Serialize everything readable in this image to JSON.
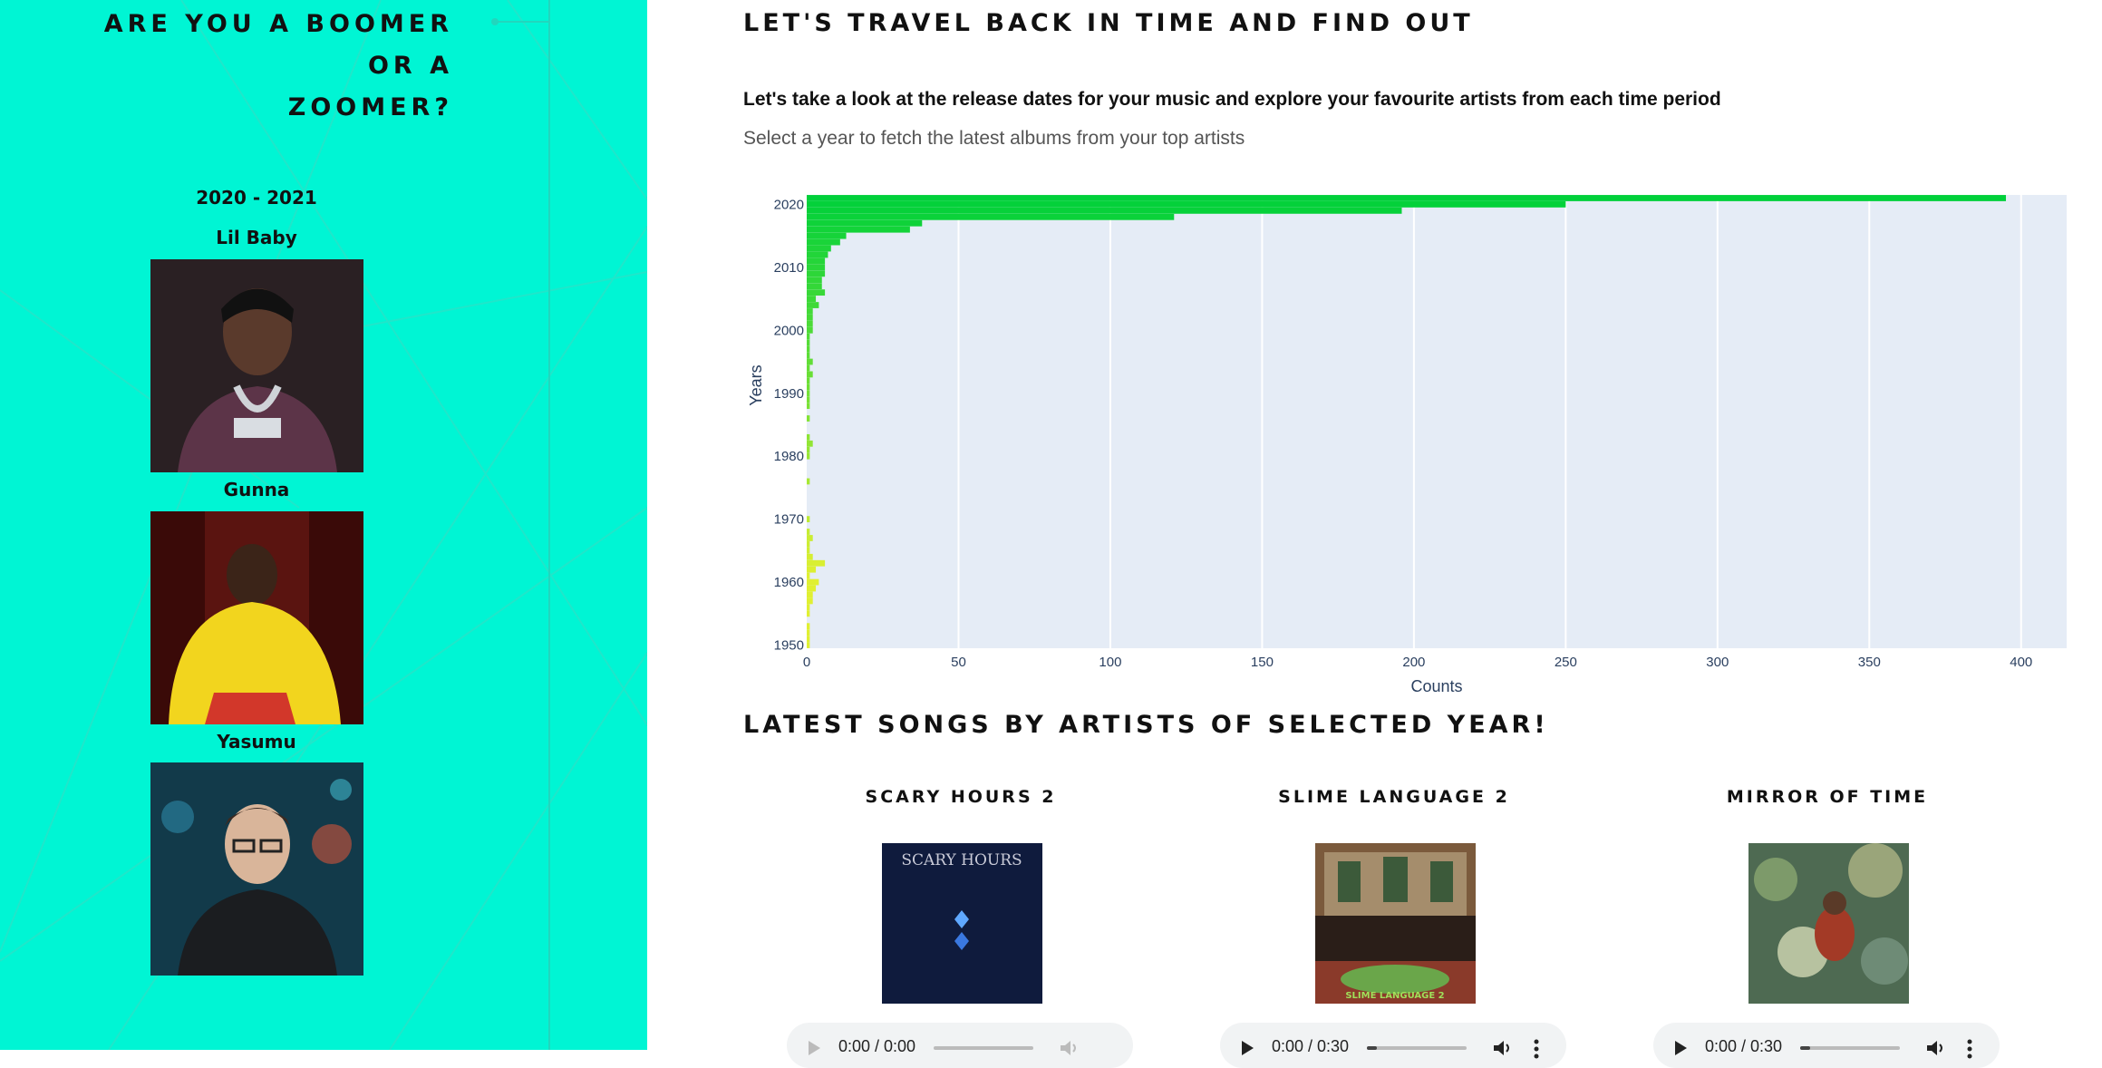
{
  "sidebar": {
    "title_line1": "ARE YOU A BOOMER OR A",
    "title_line2": "ZOOMER?",
    "year_range": "2020 - 2021",
    "artists": [
      {
        "name": "Lil Baby"
      },
      {
        "name": "Gunna"
      },
      {
        "name": "Yasumu"
      }
    ]
  },
  "main": {
    "heading": "LET'S TRAVEL BACK IN TIME AND FIND OUT",
    "intro": "Let's take a look at the release dates for your music and explore your favourite artists from each time period",
    "hint": "Select a year to fetch the latest albums from your top artists",
    "songs_heading": "LATEST SONGS BY ARTISTS OF SELECTED YEAR!"
  },
  "albums": [
    {
      "title": "SCARY HOURS 2",
      "cover_text": "SCARY HOURS",
      "player_time": "0:00 / 0:00",
      "progress": 0,
      "disabled": true
    },
    {
      "title": "SLIME LANGUAGE 2",
      "cover_text": "SLIME LANGUAGE 2",
      "player_time": "0:00 / 0:30",
      "progress": 0.1,
      "disabled": false
    },
    {
      "title": "MIRROR OF TIME",
      "cover_text": "",
      "player_time": "0:00 / 0:30",
      "progress": 0.1,
      "disabled": false
    }
  ],
  "colors": {
    "panel": "#00f5d4",
    "plot_bg": "#e5ecf6",
    "bar_recent": "#00d03a",
    "bar_old": "#e0f032"
  },
  "chart_data": {
    "type": "bar",
    "orientation": "horizontal",
    "xlabel": "Counts",
    "ylabel": "Years",
    "xlim": [
      0,
      415
    ],
    "ylim": [
      1950,
      2021
    ],
    "x_ticks": [
      0,
      50,
      100,
      150,
      200,
      250,
      300,
      350,
      400
    ],
    "y_ticks": [
      1950,
      1960,
      1970,
      1980,
      1990,
      2000,
      2010,
      2020
    ],
    "grid": true,
    "years": [
      2021,
      2020,
      2019,
      2018,
      2017,
      2016,
      2015,
      2014,
      2013,
      2012,
      2011,
      2010,
      2009,
      2008,
      2007,
      2006,
      2005,
      2004,
      2003,
      2002,
      2001,
      2000,
      1999,
      1998,
      1997,
      1996,
      1995,
      1994,
      1993,
      1992,
      1991,
      1990,
      1989,
      1988,
      1987,
      1986,
      1985,
      1984,
      1983,
      1982,
      1981,
      1980,
      1979,
      1978,
      1977,
      1976,
      1975,
      1974,
      1973,
      1972,
      1971,
      1970,
      1969,
      1968,
      1967,
      1966,
      1965,
      1964,
      1963,
      1962,
      1961,
      1960,
      1959,
      1958,
      1957,
      1956,
      1955,
      1954,
      1953,
      1952,
      1951,
      1950
    ],
    "counts": [
      395,
      250,
      196,
      121,
      38,
      34,
      13,
      11,
      8,
      7,
      6,
      6,
      6,
      5,
      5,
      6,
      3,
      4,
      2,
      2,
      2,
      2,
      1,
      1,
      1,
      1,
      2,
      1,
      2,
      1,
      1,
      1,
      1,
      1,
      0,
      1,
      0,
      0,
      1,
      2,
      1,
      1,
      0,
      0,
      0,
      1,
      0,
      0,
      0,
      0,
      0,
      1,
      0,
      1,
      2,
      1,
      1,
      2,
      6,
      3,
      1,
      4,
      3,
      2,
      2,
      1,
      1,
      0,
      1,
      1,
      1,
      1
    ]
  }
}
